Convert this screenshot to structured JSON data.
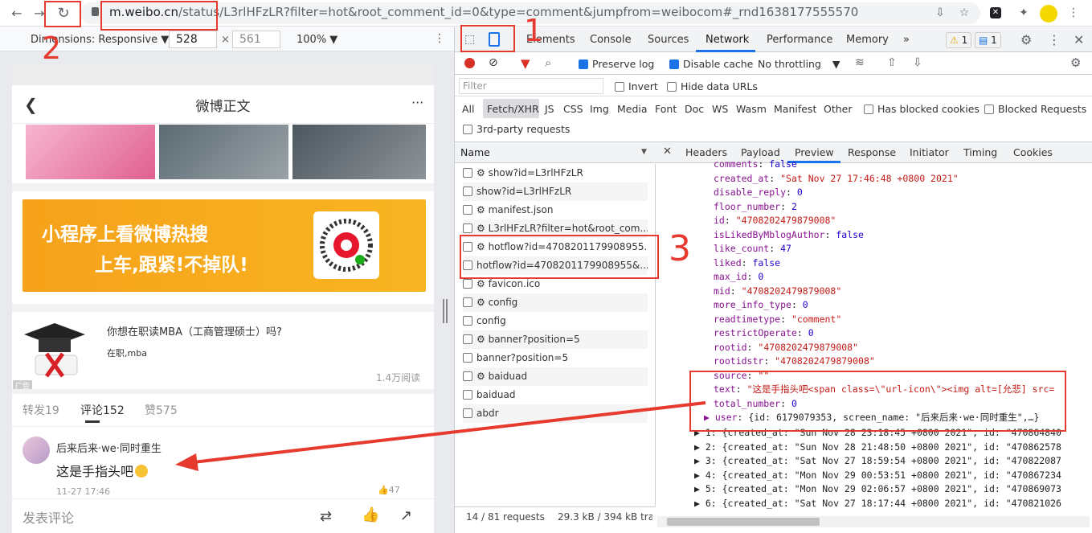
{
  "browser": {
    "url_host": "m.weibo.cn",
    "url_path": "/status/L3rlHFzLR?filter=hot&root_comment_id=0&type=comment&jumpfrom=weibocom#_rnd1638177555570"
  },
  "device_toolbar": {
    "dimensions_label": "Dimensions: Responsive ▼",
    "width": "528",
    "times": "×",
    "height": "561",
    "zoom": "100% ▼"
  },
  "mobile": {
    "page_title": "微博正文",
    "banner": {
      "line1": "小程序上看微博热搜",
      "line2": "上车,跟紧!不掉队!"
    },
    "ad": {
      "title": "你想在职读MBA（工商管理硕士）吗?",
      "subtitle": "在职,mba",
      "views": "1.4万阅读",
      "ad_tag": "广告"
    },
    "tabs": [
      {
        "label": "转发19"
      },
      {
        "label": "评论152"
      },
      {
        "label": "赞575"
      }
    ],
    "comment": {
      "user": "后来后来·we·同时重生",
      "text": "这是手指头吧",
      "time": "11-27 17:46",
      "likes": "47"
    },
    "post_label": "发表评论"
  },
  "devtools": {
    "tabs": [
      "Elements",
      "Console",
      "Sources",
      "Network",
      "Performance",
      "Memory",
      "»"
    ],
    "active_tab": "Network",
    "warn_count": "1",
    "msg_count": "1",
    "toolbar": {
      "preserve_log": "Preserve log",
      "disable_cache": "Disable cache",
      "throttling": "No throttling"
    },
    "filter": {
      "placeholder": "Filter",
      "invert": "Invert",
      "hide_data_urls": "Hide data URLs"
    },
    "types": [
      "All",
      "Fetch/XHR",
      "JS",
      "CSS",
      "Img",
      "Media",
      "Font",
      "Doc",
      "WS",
      "Wasm",
      "Manifest",
      "Other"
    ],
    "has_blocked_cookies": "Has blocked cookies",
    "blocked_requests": "Blocked Requests",
    "third_party": "3rd-party requests",
    "name_header": "Name",
    "requests": [
      "⚙ show?id=L3rlHFzLR",
      "show?id=L3rlHFzLR",
      "⚙ manifest.json",
      "⚙ L3rlHFzLR?filter=hot&root_com...",
      "⚙ hotflow?id=4708201179908955...",
      "hotflow?id=4708201179908955&...",
      "⚙ favicon.ico",
      "⚙ config",
      "config",
      "⚙ banner?position=5",
      "banner?position=5",
      "⚙ baiduad",
      "baiduad",
      "abdr"
    ],
    "footer_requests": "14 / 81 requests",
    "footer_size": "29.3 kB / 394 kB trar",
    "panel_tabs": [
      "Headers",
      "Payload",
      "Preview",
      "Response",
      "Initiator",
      "Timing",
      "Cookies"
    ],
    "active_panel_tab": "Preview",
    "preview_lines": [
      {
        "k": "comments",
        "v": "false",
        "t": "n"
      },
      {
        "k": "created_at",
        "v": "\"Sat Nov 27 17:46:48 +0800 2021\"",
        "t": "s"
      },
      {
        "k": "disable_reply",
        "v": "0",
        "t": "n"
      },
      {
        "k": "floor_number",
        "v": "2",
        "t": "n"
      },
      {
        "k": "id",
        "v": "\"4708202479879008\"",
        "t": "s"
      },
      {
        "k": "isLikedByMblogAuthor",
        "v": "false",
        "t": "n"
      },
      {
        "k": "like_count",
        "v": "47",
        "t": "n"
      },
      {
        "k": "liked",
        "v": "false",
        "t": "n"
      },
      {
        "k": "max_id",
        "v": "0",
        "t": "n"
      },
      {
        "k": "mid",
        "v": "\"4708202479879008\"",
        "t": "s"
      },
      {
        "k": "more_info_type",
        "v": "0",
        "t": "n"
      },
      {
        "k": "readtimetype",
        "v": "\"comment\"",
        "t": "s"
      },
      {
        "k": "restrictOperate",
        "v": "0",
        "t": "n"
      },
      {
        "k": "rootid",
        "v": "\"4708202479879008\"",
        "t": "s"
      },
      {
        "k": "rootidstr",
        "v": "\"4708202479879008\"",
        "t": "s"
      },
      {
        "k": "source",
        "v": "\"\"",
        "t": "s"
      },
      {
        "k": "text",
        "v": "\"这是手指头吧<span class=\\\"url-icon\\\"><img alt=[允悲] src=",
        "t": "s"
      },
      {
        "k": "total_number",
        "v": "0",
        "t": "n"
      },
      {
        "k": "▶ user",
        "v": "{id: 6179079353, screen_name: \"后来后来·we·同时重生\",…}",
        "t": "p"
      }
    ],
    "array_lines": [
      "▶ 1: {created_at: \"Sun Nov 28 23:18:45 +0800 2021\", id: \"470864840",
      "▶ 2: {created_at: \"Sun Nov 28 21:48:50 +0800 2021\", id: \"470862578",
      "▶ 3: {created_at: \"Sat Nov 27 18:59:54 +0800 2021\", id: \"470822087",
      "▶ 4: {created_at: \"Mon Nov 29 00:53:51 +0800 2021\", id: \"470867234",
      "▶ 5: {created_at: \"Mon Nov 29 02:06:57 +0800 2021\", id: \"470869073",
      "▶ 6: {created_at: \"Sat Nov 27 18:17:44 +0800 2021\", id: \"470821026"
    ]
  },
  "annotations": {
    "n1": "1",
    "n2": "2",
    "n3": "3"
  },
  "colors": {
    "accent": "#1a73e8",
    "annotation": "#e63a2e",
    "banner": "#f8b522"
  }
}
